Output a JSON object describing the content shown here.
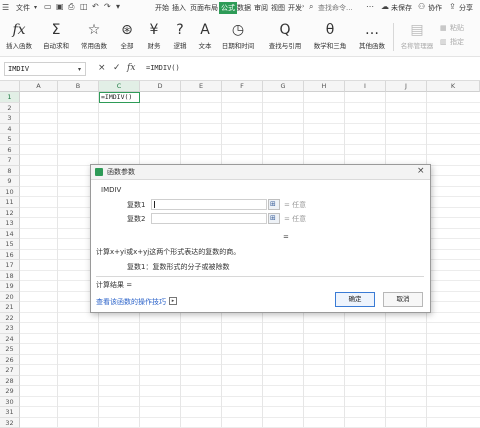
{
  "menubar": {
    "file": "文件",
    "tabs": [
      "开始",
      "插入",
      "页面布局",
      "公式",
      "数据",
      "审阅",
      "视图",
      "开发"
    ],
    "active_tab": "公式",
    "search": "查找命令...",
    "sync": "未保存",
    "collab": "协作",
    "share": "分享"
  },
  "ribbon": {
    "items": [
      {
        "glyph": "fx",
        "label": "插入函数"
      },
      {
        "glyph": "Σ",
        "label": "自动求和"
      },
      {
        "glyph": "☆",
        "label": "常用函数"
      },
      {
        "glyph": "⊛",
        "label": "全部"
      },
      {
        "glyph": "¥",
        "label": "财务"
      },
      {
        "glyph": "?",
        "label": "逻辑"
      },
      {
        "glyph": "A",
        "label": "文本"
      },
      {
        "glyph": "◷",
        "label": "日期和时间"
      },
      {
        "glyph": "Q",
        "label": "查找与引用"
      },
      {
        "glyph": "θ",
        "label": "数学和三角"
      },
      {
        "glyph": "…",
        "label": "其他函数"
      }
    ],
    "name_manager": "名称管理器",
    "paste": "粘贴",
    "define": "指定"
  },
  "formula_bar": {
    "name_box": "IMDIV",
    "cancel": "×",
    "confirm": "✓",
    "fx": "fx",
    "content": "=IMDIV()"
  },
  "sheet": {
    "columns": [
      "A",
      "B",
      "C",
      "D",
      "E",
      "F",
      "G",
      "H",
      "I",
      "J",
      "K"
    ],
    "rows": [
      "1",
      "2",
      "3",
      "4",
      "5",
      "6",
      "7",
      "8",
      "9",
      "10",
      "11",
      "12",
      "13",
      "14",
      "15",
      "16",
      "17",
      "18",
      "19",
      "20",
      "21",
      "22",
      "23",
      "24",
      "25",
      "26",
      "27",
      "28",
      "29",
      "30",
      "31",
      "32"
    ],
    "active_cell_text": "=IMDIV()"
  },
  "dialog": {
    "title": "函数参数",
    "function_name": "IMDIV",
    "arg1_label": "复数1",
    "arg1_result": "= 任意",
    "arg2_label": "复数2",
    "arg2_result": "= 任意",
    "result_eq": "=",
    "description": "计算x+yi或x+yj这两个形式表达的复数的商。",
    "arg_detail": "复数1：复数形式的分子或被除数",
    "calc_result": "计算结果 =",
    "help_link": "查看该函数的操作技巧",
    "ok": "确定",
    "cancel": "取消"
  },
  "colors": {
    "accent": "#2e9b57",
    "link": "#2a62c9",
    "primary_border": "#3a7bd5"
  }
}
